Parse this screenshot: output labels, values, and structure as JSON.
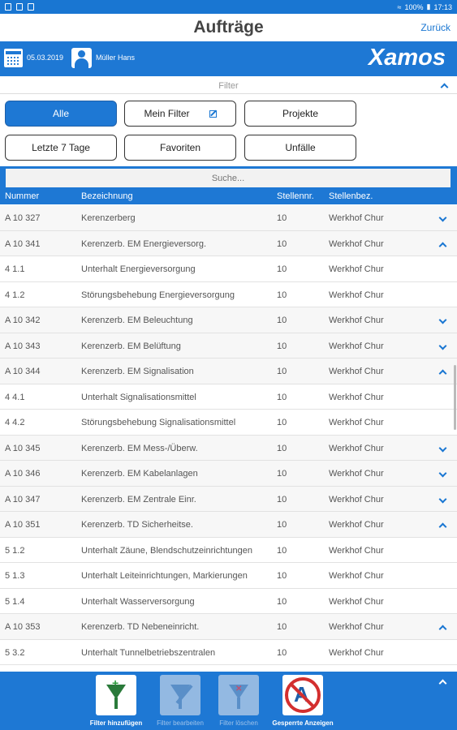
{
  "statusbar": {
    "battery": "100%",
    "time": "17:13"
  },
  "titlebar": {
    "title": "Aufträge",
    "back": "Zurück"
  },
  "header": {
    "date": "05.03.2019",
    "user": "Müller Hans",
    "logo": "Xamos"
  },
  "filter": {
    "label": "Filter",
    "buttons": [
      "Alle",
      "Mein Filter",
      "Projekte",
      "Letzte 7 Tage",
      "Favoriten",
      "Unfälle"
    ],
    "active": "Alle"
  },
  "search": {
    "placeholder": "Suche..."
  },
  "table": {
    "columns": [
      "Nummer",
      "Bezeichnung",
      "Stellennr.",
      "Stellenbez."
    ],
    "rows": [
      {
        "nr": "A 10 327",
        "bez": "Kerenzerberg",
        "stnr": "10",
        "stbez": "Werkhof Chur",
        "toggle": "down"
      },
      {
        "nr": "A 10 341",
        "bez": "Kerenzerb. EM Energieversorg.",
        "stnr": "10",
        "stbez": "Werkhof Chur",
        "toggle": "up"
      },
      {
        "nr": "4 1.1",
        "bez": "Unterhalt Energieversorgung",
        "stnr": "10",
        "stbez": "Werkhof Chur",
        "toggle": ""
      },
      {
        "nr": "4 1.2",
        "bez": "Störungsbehebung Energieversorgung",
        "stnr": "10",
        "stbez": "Werkhof Chur",
        "toggle": ""
      },
      {
        "nr": "A 10 342",
        "bez": "Kerenzerb. EM Beleuchtung",
        "stnr": "10",
        "stbez": "Werkhof Chur",
        "toggle": "down"
      },
      {
        "nr": "A 10 343",
        "bez": "Kerenzerb. EM Belüftung",
        "stnr": "10",
        "stbez": "Werkhof Chur",
        "toggle": "down"
      },
      {
        "nr": "A 10 344",
        "bez": "Kerenzerb. EM Signalisation",
        "stnr": "10",
        "stbez": "Werkhof Chur",
        "toggle": "up"
      },
      {
        "nr": "4 4.1",
        "bez": "Unterhalt Signalisationsmittel",
        "stnr": "10",
        "stbez": "Werkhof Chur",
        "toggle": ""
      },
      {
        "nr": "4 4.2",
        "bez": "Störungsbehebung Signalisationsmittel",
        "stnr": "10",
        "stbez": "Werkhof Chur",
        "toggle": ""
      },
      {
        "nr": "A 10 345",
        "bez": "Kerenzerb. EM Mess-/Überw.",
        "stnr": "10",
        "stbez": "Werkhof Chur",
        "toggle": "down"
      },
      {
        "nr": "A 10 346",
        "bez": "Kerenzerb. EM Kabelanlagen",
        "stnr": "10",
        "stbez": "Werkhof Chur",
        "toggle": "down"
      },
      {
        "nr": "A 10 347",
        "bez": "Kerenzerb. EM Zentrale Einr.",
        "stnr": "10",
        "stbez": "Werkhof Chur",
        "toggle": "down"
      },
      {
        "nr": "A 10 351",
        "bez": "Kerenzerb. TD Sicherheitse.",
        "stnr": "10",
        "stbez": "Werkhof Chur",
        "toggle": "up"
      },
      {
        "nr": "5 1.2",
        "bez": "Unterhalt Zäune, Blendschutzeinrichtungen",
        "stnr": "10",
        "stbez": "Werkhof Chur",
        "toggle": ""
      },
      {
        "nr": "5 1.3",
        "bez": "Unterhalt Leiteinrichtungen, Markierungen",
        "stnr": "10",
        "stbez": "Werkhof Chur",
        "toggle": ""
      },
      {
        "nr": "5 1.4",
        "bez": "Unterhalt Wasserversorgung",
        "stnr": "10",
        "stbez": "Werkhof Chur",
        "toggle": ""
      },
      {
        "nr": "A 10 353",
        "bez": "Kerenzerb. TD Nebeneinricht.",
        "stnr": "10",
        "stbez": "Werkhof Chur",
        "toggle": "up"
      },
      {
        "nr": "5 3.2",
        "bez": "Unterhalt Tunnelbetriebszentralen",
        "stnr": "10",
        "stbez": "Werkhof Chur",
        "toggle": ""
      }
    ]
  },
  "footer": {
    "add": "Filter hinzufügen",
    "edit": "Filter bearbeiten",
    "delete": "Filter löschen",
    "blocked": "Gesperrte Anzeigen"
  }
}
